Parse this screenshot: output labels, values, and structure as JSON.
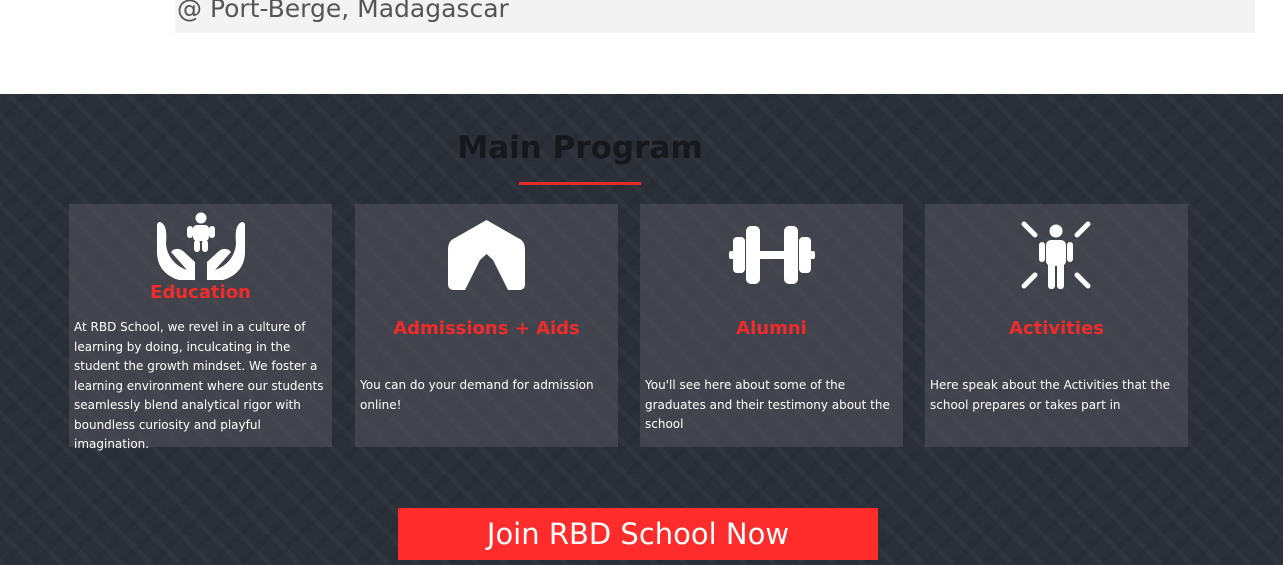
{
  "location": {
    "text": "@ Port-Berge, Madagascar"
  },
  "program": {
    "title": "Main Program",
    "cards": [
      {
        "icon": "child-care-hands-icon",
        "title": "Education",
        "description": "At RBD School, we revel in a culture of learning by doing, inculcating in the student the growth mindset. We foster a learning environment where our students seamlessly blend analytical rigor with boundless curiosity and playful imagination."
      },
      {
        "icon": "tent-icon",
        "title": "Admissions + Aids",
        "description": "You can do your demand for admission online!"
      },
      {
        "icon": "dumbbell-icon",
        "title": "Alumni",
        "description": "You'll see here about some of the graduates and their testimony about the school"
      },
      {
        "icon": "person-radiating-icon",
        "title": "Activities",
        "description": "Here speak about the Activities that the school prepares or takes part in"
      }
    ]
  },
  "cta": {
    "label": "Join RBD School Now"
  },
  "colors": {
    "accent": "#e52a2a",
    "card_title": "#f02b2b",
    "button": "#ff2c2c",
    "section_background": "#2b2f38"
  }
}
